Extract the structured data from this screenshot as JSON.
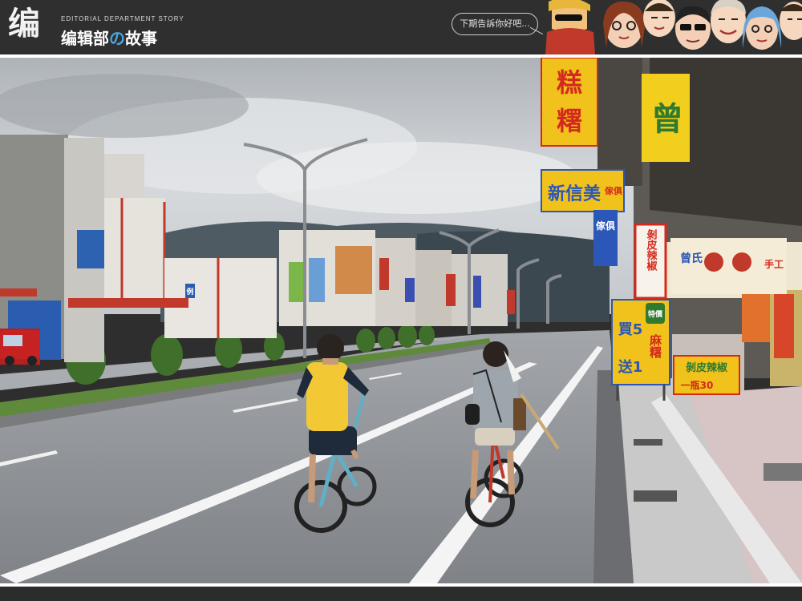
{
  "header": {
    "logo_mark": "编",
    "logo_subtitle": "EDITORIAL DEPARTMENT STORY",
    "logo_title_part1": "编辑部",
    "logo_title_part2": "の",
    "logo_title_part3": "故事",
    "speech_bubble": "下期告訴你好吧..."
  },
  "photo": {
    "signs": {
      "sign_1_line1": "糕",
      "sign_1_line2": "糬",
      "sign_2": "新信美",
      "sign_2_side": "傢俱",
      "sign_3": "曾",
      "sign_4": "剝皮辣椒",
      "sign_5_top": "特價",
      "sign_5_line1": "買5",
      "sign_5_line2": "送1",
      "sign_5_right": "麻糬",
      "sign_6": "剝皮辣椒",
      "sign_6_price": "一瓶30",
      "sign_7": "曾氏",
      "sign_7_side": "手工",
      "sign_8": "傢俱",
      "road_sign": "例"
    }
  },
  "colors": {
    "header_bg": "#2f2f2f",
    "sky": "#c9cdd1",
    "road": "#8f9296",
    "sign_yellow": "#f2c21c",
    "sign_red": "#d42a1e",
    "sign_blue": "#2a57b8"
  }
}
